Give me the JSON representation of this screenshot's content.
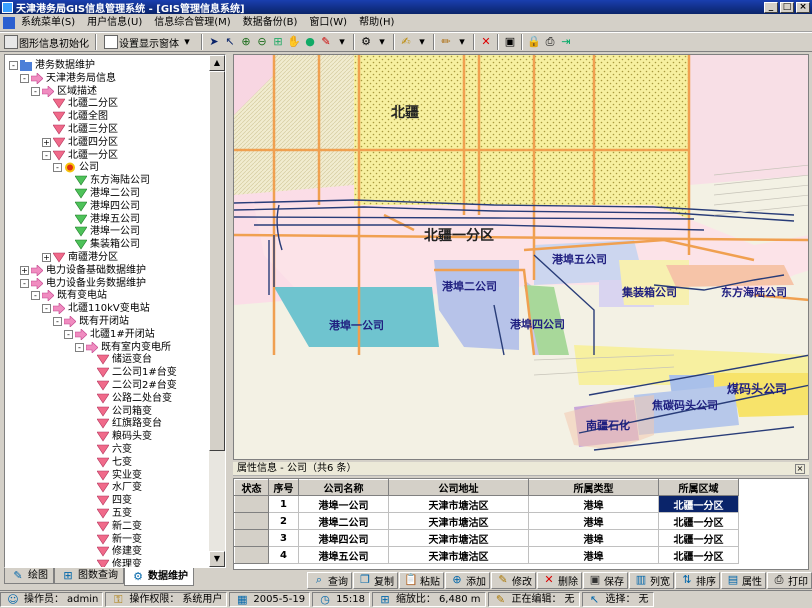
{
  "window": {
    "title": "天津港务局GIS信息管理系统 - [GIS管理信息系统]"
  },
  "menu": [
    "系统菜单(S)",
    "用户信息(U)",
    "信息综合管理(M)",
    "数据备份(B)",
    "窗口(W)",
    "帮助(H)"
  ],
  "toolbar": {
    "init_label": "图形信息初始化",
    "display_label": "设置显示窗体"
  },
  "tree": [
    {
      "label": "港务数据维护",
      "level": 0,
      "exp": "-",
      "icon": "folder"
    },
    {
      "label": "天津港务局信息",
      "level": 1,
      "exp": "-",
      "icon": "arrow"
    },
    {
      "label": "区域描述",
      "level": 2,
      "exp": "-",
      "icon": "arrow"
    },
    {
      "label": "北疆二分区",
      "level": 3,
      "exp": "",
      "icon": "tri"
    },
    {
      "label": "北疆全图",
      "level": 3,
      "exp": "",
      "icon": "tri"
    },
    {
      "label": "北疆三分区",
      "level": 3,
      "exp": "",
      "icon": "tri"
    },
    {
      "label": "北疆四分区",
      "level": 3,
      "exp": "+",
      "icon": "tri"
    },
    {
      "label": "北疆一分区",
      "level": 3,
      "exp": "-",
      "icon": "tri"
    },
    {
      "label": "公司",
      "level": 4,
      "exp": "-",
      "icon": "sun"
    },
    {
      "label": "东方海陆公司",
      "level": 5,
      "exp": "",
      "icon": "gtri"
    },
    {
      "label": "港埠二公司",
      "level": 5,
      "exp": "",
      "icon": "gtri"
    },
    {
      "label": "港埠四公司",
      "level": 5,
      "exp": "",
      "icon": "gtri"
    },
    {
      "label": "港埠五公司",
      "level": 5,
      "exp": "",
      "icon": "gtri"
    },
    {
      "label": "港埠一公司",
      "level": 5,
      "exp": "",
      "icon": "gtri"
    },
    {
      "label": "集装箱公司",
      "level": 5,
      "exp": "",
      "icon": "gtri"
    },
    {
      "label": "南疆港分区",
      "level": 3,
      "exp": "+",
      "icon": "tri"
    },
    {
      "label": "电力设备基础数据维护",
      "level": 1,
      "exp": "+",
      "icon": "arrow"
    },
    {
      "label": "电力设备业务数据维护",
      "level": 1,
      "exp": "-",
      "icon": "arrow"
    },
    {
      "label": "既有变电站",
      "level": 2,
      "exp": "-",
      "icon": "arrow"
    },
    {
      "label": "北疆110kV变电站",
      "level": 3,
      "exp": "-",
      "icon": "arrow"
    },
    {
      "label": "既有开闭站",
      "level": 4,
      "exp": "-",
      "icon": "arrow"
    },
    {
      "label": "北疆1#开闭站",
      "level": 5,
      "exp": "-",
      "icon": "arrow"
    },
    {
      "label": "既有室内变电所",
      "level": 6,
      "exp": "-",
      "icon": "arrow"
    },
    {
      "label": "储运变台",
      "level": 7,
      "exp": "",
      "icon": "tri"
    },
    {
      "label": "二公司1#台变",
      "level": 7,
      "exp": "",
      "icon": "tri"
    },
    {
      "label": "二公司2#台变",
      "level": 7,
      "exp": "",
      "icon": "tri"
    },
    {
      "label": "公路二处台变",
      "level": 7,
      "exp": "",
      "icon": "tri"
    },
    {
      "label": "公司箱变",
      "level": 7,
      "exp": "",
      "icon": "tri"
    },
    {
      "label": "红旗路变台",
      "level": 7,
      "exp": "",
      "icon": "tri"
    },
    {
      "label": "粮码头变",
      "level": 7,
      "exp": "",
      "icon": "tri"
    },
    {
      "label": "六变",
      "level": 7,
      "exp": "",
      "icon": "tri"
    },
    {
      "label": "七变",
      "level": 7,
      "exp": "",
      "icon": "tri"
    },
    {
      "label": "实业变",
      "level": 7,
      "exp": "",
      "icon": "tri"
    },
    {
      "label": "水厂变",
      "level": 7,
      "exp": "",
      "icon": "tri"
    },
    {
      "label": "四变",
      "level": 7,
      "exp": "",
      "icon": "tri"
    },
    {
      "label": "五变",
      "level": 7,
      "exp": "",
      "icon": "tri"
    },
    {
      "label": "新二变",
      "level": 7,
      "exp": "",
      "icon": "tri"
    },
    {
      "label": "新一变",
      "level": 7,
      "exp": "",
      "icon": "tri"
    },
    {
      "label": "修建变",
      "level": 7,
      "exp": "",
      "icon": "tri"
    },
    {
      "label": "修理变",
      "level": 7,
      "exp": "",
      "icon": "tri"
    }
  ],
  "left_tabs": [
    "绘图",
    "图数查询",
    "数据维护"
  ],
  "map": {
    "labels": {
      "beijiang": "北疆",
      "area1": "北疆一分区",
      "gb5": "港埠五公司",
      "gb2": "港埠二公司",
      "jzx": "集装箱公司",
      "dfhl": "东方海陆公司",
      "gb1": "港埠一公司",
      "gb4": "港埠四公司",
      "mtgs": "煤码头公司",
      "jtmt": "焦碳码头公司",
      "njsh": "南疆石化"
    },
    "colors": {
      "water": "#f3f1e4",
      "land": "#fbe3e6",
      "yellow_dots": "#f7f0a0",
      "blue_block": "#6fc4cf",
      "road": "#f0a050",
      "rail": "#283c78"
    }
  },
  "attr": {
    "title": "属性信息 - 公司（共6 条）"
  },
  "grid": {
    "headers": [
      "状态",
      "序号",
      "公司名称",
      "公司地址",
      "所属类型",
      "所属区域"
    ],
    "rows": [
      [
        "",
        "1",
        "港埠一公司",
        "天津市塘沽区",
        "港埠",
        "北疆一分区"
      ],
      [
        "",
        "2",
        "港埠二公司",
        "天津市塘沽区",
        "港埠",
        "北疆一分区"
      ],
      [
        "",
        "3",
        "港埠四公司",
        "天津市塘沽区",
        "港埠",
        "北疆一分区"
      ],
      [
        "",
        "4",
        "港埠五公司",
        "天津市塘沽区",
        "港埠",
        "北疆一分区"
      ]
    ]
  },
  "buttons": [
    "查询",
    "复制",
    "粘贴",
    "添加",
    "修改",
    "删除",
    "保存",
    "列宽",
    "排序",
    "属性",
    "打印"
  ],
  "status": {
    "operator_label": "操作员：",
    "operator": "admin",
    "perm_label": "操作权限：",
    "perm": "系统用户",
    "date": "2005-5-19",
    "time": "15:18",
    "scale_label": "缩放比：",
    "scale": "6,480 m",
    "edit_label": "正在编辑：",
    "edit": "无",
    "select_label": "选择：",
    "select": "无"
  }
}
